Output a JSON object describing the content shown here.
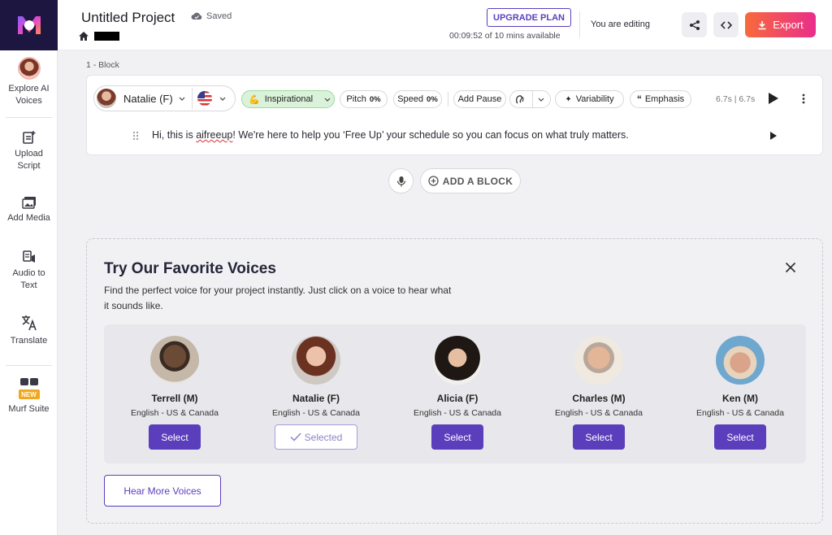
{
  "sidebar": {
    "items": [
      {
        "label": "Explore AI Voices"
      },
      {
        "label": "Upload Script"
      },
      {
        "label": "Add Media"
      },
      {
        "label": "Audio to Text"
      },
      {
        "label": "Translate"
      },
      {
        "label": "Murf Suite",
        "badge": "NEW"
      }
    ]
  },
  "header": {
    "project_title": "Untitled Project",
    "save_status": "Saved",
    "upgrade_label": "UPGRADE PLAN",
    "time_available": "00:09:52 of 10 mins available",
    "editing_status": "You are editing",
    "export_label": "Export"
  },
  "block": {
    "label": "1 -  Block",
    "voice_name": "Natalie (F)",
    "style": "Inspirational",
    "pitch_label": "Pitch",
    "pitch_value": "0%",
    "speed_label": "Speed",
    "speed_value": "0%",
    "add_pause_label": "Add Pause",
    "variability_label": "Variability",
    "emphasis_label": "Emphasis",
    "duration": "6.7s | 6.7s",
    "text_before": "Hi, this is ",
    "text_misspelled": "aifreeup",
    "text_after": "! We're here to help you ‘Free Up’ your schedule so you can focus on what truly matters."
  },
  "add_block_label": "ADD A BLOCK",
  "voices_panel": {
    "title": "Try Our Favorite Voices",
    "description": "Find the perfect voice for your project instantly. Just click on a voice to hear what it sounds like.",
    "voices": [
      {
        "name": "Terrell (M)",
        "lang": "English - US & Canada",
        "button": "Select"
      },
      {
        "name": "Natalie (F)",
        "lang": "English - US & Canada",
        "button": "Selected"
      },
      {
        "name": "Alicia (F)",
        "lang": "English - US & Canada",
        "button": "Select"
      },
      {
        "name": "Charles (M)",
        "lang": "English - US & Canada",
        "button": "Select"
      },
      {
        "name": "Ken (M)",
        "lang": "English - US & Canada",
        "button": "Select"
      }
    ],
    "hear_more_label": "Hear More Voices"
  },
  "colors": {
    "brand_purple": "#5a3ebc",
    "export_gradient_start": "#f76a3c",
    "export_gradient_end": "#ea2d8a",
    "logo_bg": "#1d1640",
    "inspirational_bg": "#d9f2d9"
  }
}
